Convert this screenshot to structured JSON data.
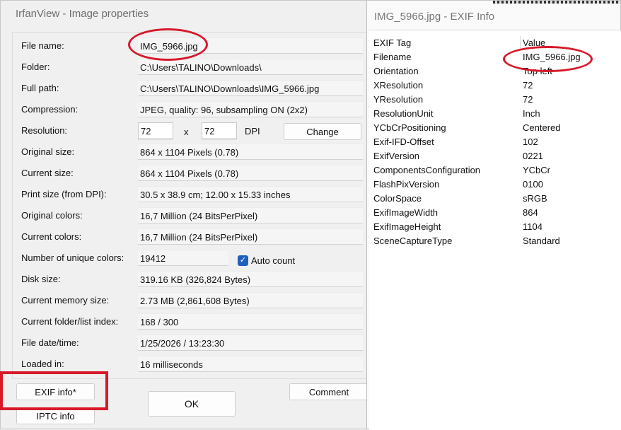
{
  "properties_window": {
    "title": "IrfanView - Image properties",
    "fields": {
      "file_name": {
        "label": "File name:",
        "value": "IMG_5966.jpg"
      },
      "folder": {
        "label": "Folder:",
        "value": "C:\\Users\\TALINO\\Downloads\\"
      },
      "full_path": {
        "label": "Full path:",
        "value": "C:\\Users\\TALINO\\Downloads\\IMG_5966.jpg"
      },
      "compression": {
        "label": "Compression:",
        "value": "JPEG, quality: 96, subsampling ON (2x2)"
      },
      "resolution": {
        "label": "Resolution:",
        "x": "72",
        "sep": "x",
        "y": "72",
        "unit": "DPI"
      },
      "original_size": {
        "label": "Original size:",
        "value": "864 x 1104  Pixels (0.78)"
      },
      "current_size": {
        "label": "Current size:",
        "value": "864 x 1104  Pixels (0.78)"
      },
      "print_size": {
        "label": "Print size (from DPI):",
        "value": "30.5 x 38.9 cm; 12.00 x 15.33 inches"
      },
      "original_colors": {
        "label": "Original colors:",
        "value": "16,7 Million   (24 BitsPerPixel)"
      },
      "current_colors": {
        "label": "Current colors:",
        "value": "16,7 Million   (24 BitsPerPixel)"
      },
      "unique_colors": {
        "label": "Number of unique colors:",
        "value": "19412",
        "auto_count_label": "Auto count",
        "auto_count_checked": true
      },
      "disk_size": {
        "label": "Disk size:",
        "value": "319.16 KB (326,824 Bytes)"
      },
      "memory_size": {
        "label": "Current memory size:",
        "value": "2.73  MB (2,861,608 Bytes)"
      },
      "folder_index": {
        "label": "Current folder/list index:",
        "value": "168  /  300"
      },
      "file_datetime": {
        "label": "File date/time:",
        "value": "1/25/2026 / 13:23:30"
      },
      "loaded_in": {
        "label": "Loaded in:",
        "value": "16 milliseconds"
      }
    },
    "buttons": {
      "change": "Change",
      "exif_info": "EXIF info*",
      "iptc_info": "IPTC info",
      "ok": "OK",
      "comment": "Comment"
    }
  },
  "exif_window": {
    "title": "IMG_5966.jpg - EXIF Info",
    "header": {
      "tag": "EXIF Tag",
      "value": "Value"
    },
    "rows": [
      {
        "tag": "Filename",
        "value": "IMG_5966.jpg"
      },
      {
        "tag": "Orientation",
        "value": "Top left"
      },
      {
        "tag": "XResolution",
        "value": "72"
      },
      {
        "tag": "YResolution",
        "value": "72"
      },
      {
        "tag": "ResolutionUnit",
        "value": "Inch"
      },
      {
        "tag": "YCbCrPositioning",
        "value": "Centered"
      },
      {
        "tag": "Exif-IFD-Offset",
        "value": "102"
      },
      {
        "tag": "ExifVersion",
        "value": "0221"
      },
      {
        "tag": "ComponentsConfiguration",
        "value": "YCbCr"
      },
      {
        "tag": "FlashPixVersion",
        "value": "0100"
      },
      {
        "tag": "ColorSpace",
        "value": "sRGB"
      },
      {
        "tag": "ExifImageWidth",
        "value": "864"
      },
      {
        "tag": "ExifImageHeight",
        "value": "1104"
      },
      {
        "tag": "SceneCaptureType",
        "value": "Standard"
      }
    ]
  },
  "annotation_color": "#d7192a"
}
